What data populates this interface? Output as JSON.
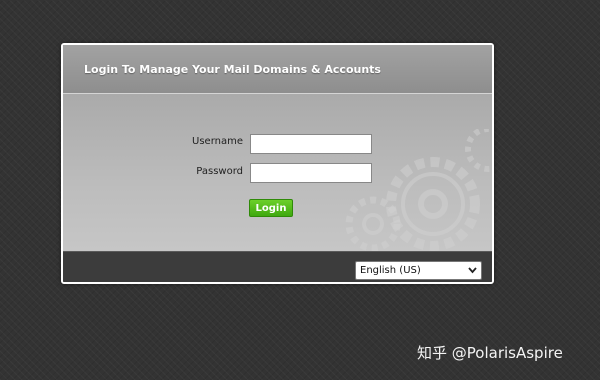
{
  "login": {
    "title": "Login To Manage Your Mail Domains & Accounts",
    "username_label": "Username",
    "username_value": "",
    "password_label": "Password",
    "password_value": "",
    "login_button": "Login"
  },
  "footer": {
    "language_selected": "English (US)"
  },
  "watermark": {
    "text": "知乎 @PolarisAspire"
  },
  "colors": {
    "background": "#333333",
    "login_button": "#4cb718",
    "footer": "#3c3c3c"
  }
}
